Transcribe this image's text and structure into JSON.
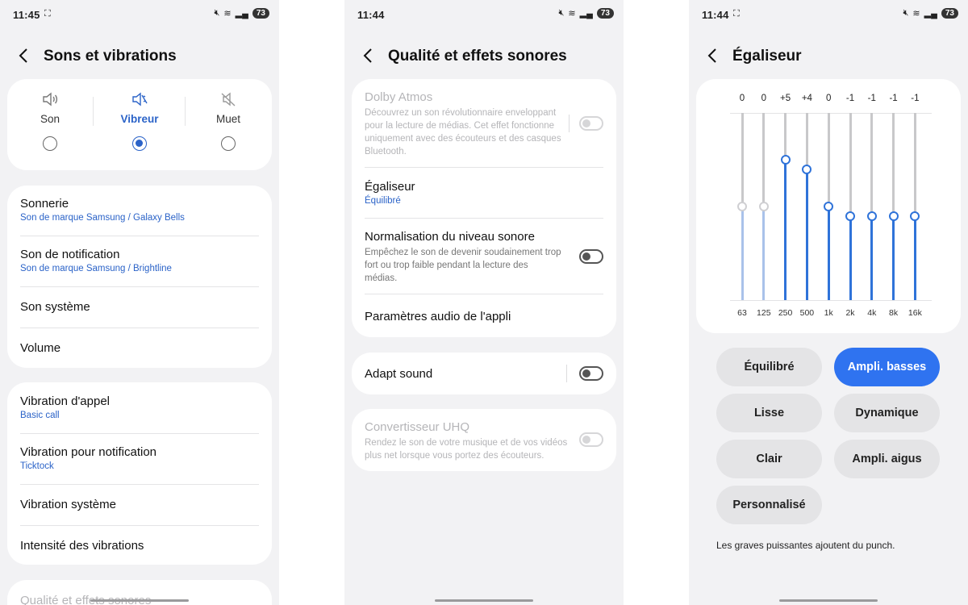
{
  "status": {
    "s1_time": "11:45",
    "s2_time": "11:44",
    "s3_time": "11:44",
    "battery": "73"
  },
  "screen1": {
    "title": "Sons et vibrations",
    "modes": [
      {
        "label": "Son",
        "selected": false
      },
      {
        "label": "Vibreur",
        "selected": true
      },
      {
        "label": "Muet",
        "selected": false
      }
    ],
    "group1": [
      {
        "label": "Sonnerie",
        "sub": "Son de marque Samsung / Galaxy Bells"
      },
      {
        "label": "Son de notification",
        "sub": "Son de marque Samsung / Brightline"
      },
      {
        "label": "Son système",
        "sub": ""
      },
      {
        "label": "Volume",
        "sub": ""
      }
    ],
    "group2": [
      {
        "label": "Vibration d'appel",
        "sub": "Basic call"
      },
      {
        "label": "Vibration pour notification",
        "sub": "Ticktock"
      },
      {
        "label": "Vibration système",
        "sub": ""
      },
      {
        "label": "Intensité des vibrations",
        "sub": ""
      }
    ],
    "partial_item": "Qualité et effets sonores"
  },
  "screen2": {
    "title": "Qualité et effets sonores",
    "dolby": {
      "label": "Dolby Atmos",
      "desc": "Découvrez un son révolutionnaire enveloppant pour la lecture de médias. Cet effet fonctionne uniquement avec des écouteurs et des casques Bluetooth.",
      "enabled": false
    },
    "equalizer": {
      "label": "Égaliseur",
      "sub": "Équilibré"
    },
    "normalization": {
      "label": "Normalisation du niveau sonore",
      "desc": "Empêchez le son de devenir soudainement trop fort ou trop faible pendant la lecture des médias.",
      "on": false
    },
    "app_audio": {
      "label": "Paramètres audio de l'appli"
    },
    "adapt": {
      "label": "Adapt sound",
      "on": false
    },
    "uhq": {
      "label": "Convertisseur UHQ",
      "desc": "Rendez le son de votre musique et de vos vidéos plus net lorsque vous portez des écouteurs.",
      "enabled": false
    }
  },
  "screen3": {
    "title": "Égaliseur",
    "bands": [
      {
        "freq": "63",
        "value": 0,
        "label": "0"
      },
      {
        "freq": "125",
        "value": 0,
        "label": "0"
      },
      {
        "freq": "250",
        "value": 5,
        "label": "+5"
      },
      {
        "freq": "500",
        "value": 4,
        "label": "+4"
      },
      {
        "freq": "1k",
        "value": 0,
        "label": "0"
      },
      {
        "freq": "2k",
        "value": -1,
        "label": "-1"
      },
      {
        "freq": "4k",
        "value": -1,
        "label": "-1"
      },
      {
        "freq": "8k",
        "value": -1,
        "label": "-1"
      },
      {
        "freq": "16k",
        "value": -1,
        "label": "-1"
      }
    ],
    "presets": [
      {
        "label": "Équilibré",
        "active": false
      },
      {
        "label": "Ampli. basses",
        "active": true
      },
      {
        "label": "Lisse",
        "active": false
      },
      {
        "label": "Dynamique",
        "active": false
      },
      {
        "label": "Clair",
        "active": false
      },
      {
        "label": "Ampli. aigus",
        "active": false
      },
      {
        "label": "Personnalisé",
        "active": false
      }
    ],
    "description": "Les graves puissantes ajoutent du punch."
  },
  "colors": {
    "accent": "#2b63c8",
    "button_active": "#2f73f0",
    "background": "#f2f2f4"
  }
}
